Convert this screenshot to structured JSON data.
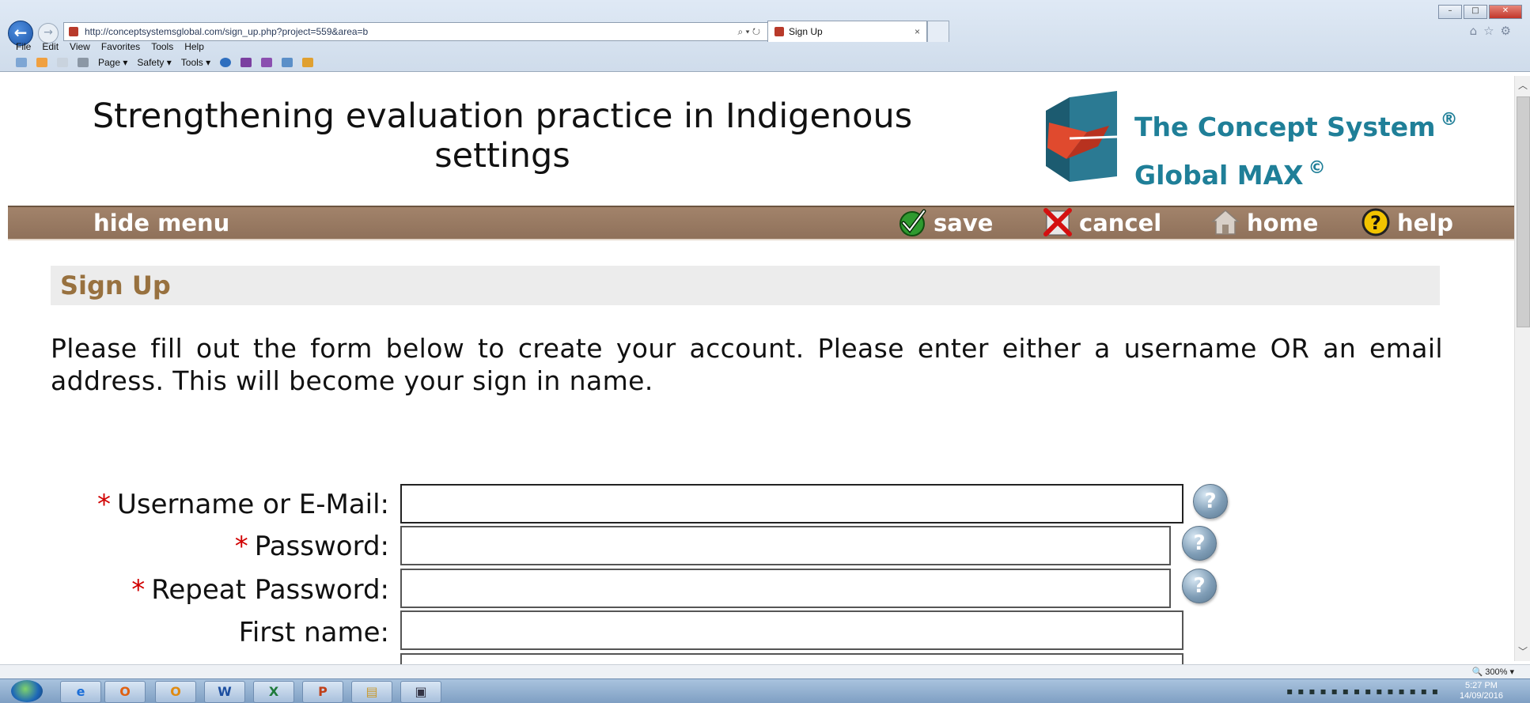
{
  "browser": {
    "url": "http://conceptsystemsglobal.com/sign_up.php?project=559&area=b",
    "address_controls": "⌕ ▾ ↻",
    "tab_title": "Sign Up",
    "tab_close": "×",
    "menu": [
      "File",
      "Edit",
      "View",
      "Favorites",
      "Tools",
      "Help"
    ],
    "commands": [
      "Page ▾",
      "Safety ▾",
      "Tools ▾"
    ],
    "zoom": "🔍 300%  ▾"
  },
  "header": {
    "title": "Strengthening evaluation practice in Indigenous settings",
    "logo_line1": "The Concept System",
    "logo_line1_mark": "®",
    "logo_line2": "Global MAX",
    "logo_line2_mark": "©"
  },
  "nav": {
    "hide_menu": "hide menu",
    "save": "save",
    "cancel": "cancel",
    "home": "home",
    "help": "help"
  },
  "signup": {
    "heading": "Sign Up",
    "intro": "Please fill out the form below to create your account. Please enter either a username OR an email address. This will become your sign in name.",
    "required_mark": "*",
    "fields": {
      "username": {
        "label": "Username or E-Mail:",
        "value": ""
      },
      "password": {
        "label": "Password:",
        "value": ""
      },
      "repeat_password": {
        "label": "Repeat Password:",
        "value": ""
      },
      "first_name": {
        "label": "First name:",
        "value": ""
      }
    },
    "help_glyph": "?"
  },
  "taskbar": {
    "apps": [
      "e",
      "O",
      "O",
      "W",
      "X",
      "P",
      "▤",
      "▣"
    ],
    "clock_time": "5:27 PM",
    "clock_date": "14/09/2016"
  },
  "colors": {
    "nav_bar": "#9b7b63",
    "heading_text": "#98713f",
    "logo_text": "#1f7f98",
    "required": "#d10000"
  }
}
